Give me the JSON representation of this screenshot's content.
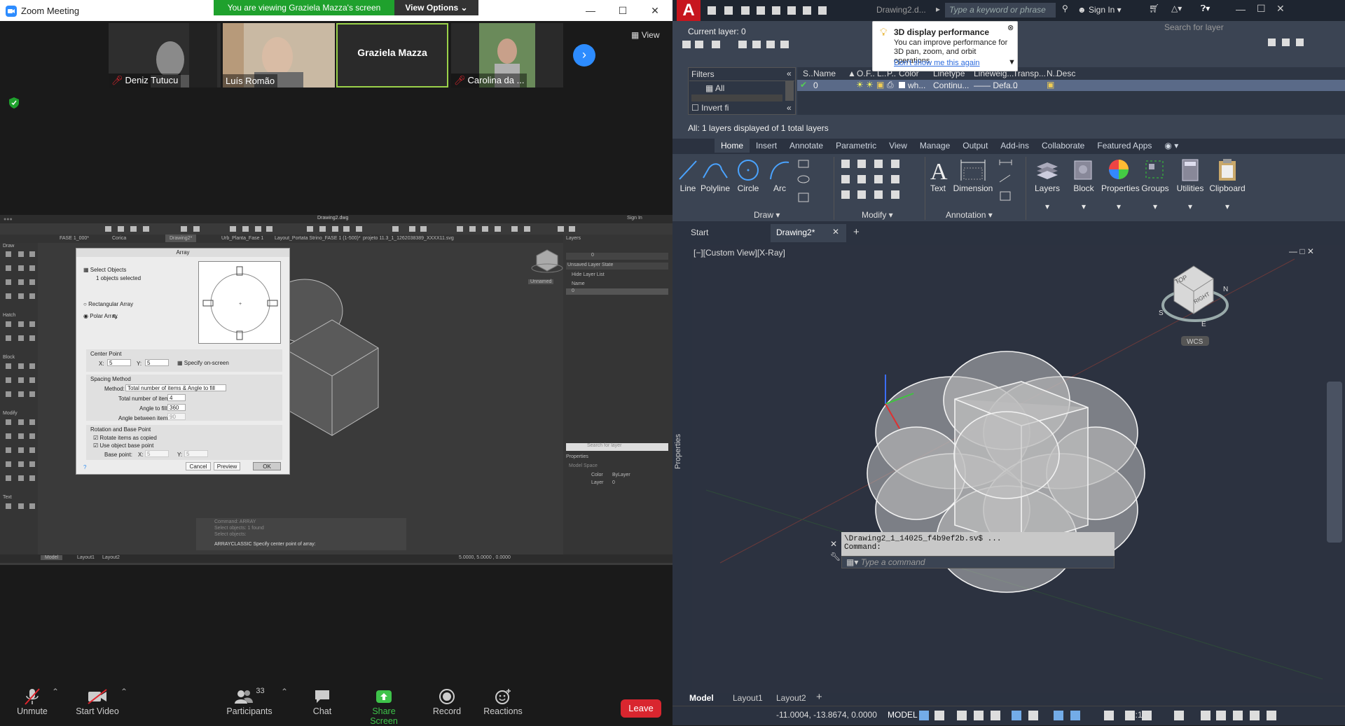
{
  "zoom": {
    "window_title": "Zoom Meeting",
    "banner_text": "You are viewing Graziela Mazza's screen",
    "view_options": "View Options",
    "view_label": "View",
    "participants": [
      {
        "name": "Deniz Tutucu",
        "muted": true
      },
      {
        "name": "Luís Romão",
        "muted": false
      },
      {
        "name": "Graziela Mazza",
        "muted": false
      },
      {
        "name": "Carolina da ...",
        "muted": true
      }
    ],
    "toolbar": {
      "unmute": "Unmute",
      "start_video": "Start Video",
      "participants": "Participants",
      "participants_count": "33",
      "chat": "Chat",
      "share_screen": "Share Screen",
      "record": "Record",
      "reactions": "Reactions",
      "leave": "Leave"
    },
    "colors": {
      "share_green": "#1fa12d",
      "leave_red": "#d9262f",
      "banner_bg": "#1fa12d"
    }
  },
  "remote": {
    "window_title": "Drawing2.dwg",
    "sign_in": "Sign In",
    "tabs": [
      "FASE 1_000*",
      "Corica",
      "Drawing2*",
      "Urb_Planta_Fase 1",
      "Layout_Portata Strino_FASE 1 (1-500)*",
      "projeto 11.3_1_1262038389_XXXX11.svg"
    ],
    "dialog": {
      "title": "Array",
      "select_objects": "Select Objects",
      "selected": "1 objects selected",
      "rect": "Rectangular Array",
      "polar": "Polar Array",
      "center_point": "Center Point",
      "x_label": "X:",
      "x_val": "5",
      "y_label": "Y:",
      "y_val": "5",
      "specify": "Specify on-screen",
      "spacing": "Spacing Method",
      "method_label": "Method:",
      "method_val": "Total number of items & Angle to fill",
      "total_label": "Total number of items:",
      "total_val": "4",
      "angle_label": "Angle to fill:",
      "angle_val": "360",
      "between_label": "Angle between items:",
      "between_val": "90",
      "rot": "Rotation and Base Point",
      "rotate": "Rotate items as copied",
      "use_base": "Use object base point",
      "base_label": "Base point:",
      "bx": "5",
      "by": "5",
      "cancel": "Cancel",
      "preview": "Preview",
      "ok": "OK",
      "help": "?"
    },
    "layers_title": "Layers",
    "layer_state": "Unsaved Layer State",
    "hide_list": "Hide Layer List",
    "name_col": "Name",
    "layer0": "0",
    "unnamed": "Unnamed",
    "search_layer": "Search for layer",
    "properties": "Properties",
    "model_space": "Model Space",
    "color_label": "Color",
    "color_val": "ByLayer",
    "layer_label": "Layer",
    "layer_val": "0",
    "cmd_lines": [
      "Command: ARRAY",
      "Select objects: 1 found",
      "Select objects:"
    ],
    "cmd_prompt": "ARRAYCLASSIC Specify center point of array:",
    "coords": "5.0000,  5.0000  ,  0.0000",
    "tabs_bottom": [
      "Model",
      "Layout1",
      "Layout2"
    ],
    "palette_sections": [
      "Draw",
      "Hatch",
      "Block",
      "Modify",
      "Text"
    ]
  },
  "acad": {
    "doc_title": "Drawing2.d...",
    "search_placeholder": "Type a keyword or phrase",
    "sign_in": "Sign In",
    "current_layer": "Current layer: 0",
    "search_layer": "Search for layer",
    "filters": "Filters",
    "all": "All",
    "invert": "Invert fi",
    "columns": [
      "S..",
      "Name",
      "O..",
      "F..",
      "L..",
      "P..",
      "Color",
      "Linetype",
      "Lineweig...",
      "Transp...",
      "N..",
      "Desc"
    ],
    "layer_row": {
      "name": "0",
      "color": "wh...",
      "linetype": "Continu...",
      "lineweight": "Defa...",
      "transp": "0"
    },
    "layers_summary": "All: 1 layers displayed of 1 total layers",
    "tooltip": {
      "title": "3D display performance",
      "body": "You can improve performance for 3D pan, zoom, and orbit operations.",
      "link": "Don't show me this again"
    },
    "ribbon_tabs": [
      "Home",
      "Insert",
      "Annotate",
      "Parametric",
      "View",
      "Manage",
      "Output",
      "Add-ins",
      "Collaborate",
      "Featured Apps"
    ],
    "draw_tools": [
      "Line",
      "Polyline",
      "Circle",
      "Arc"
    ],
    "ann_tools": [
      "Text",
      "Dimension"
    ],
    "big_tools": [
      "Layers",
      "Block",
      "Properties",
      "Groups",
      "Utilities",
      "Clipboard"
    ],
    "groups": {
      "draw": "Draw",
      "modify": "Modify",
      "annotation": "Annotation"
    },
    "doc_tabs": {
      "start": "Start",
      "drawing": "Drawing2*"
    },
    "viewport_label": "[−][Custom View][X-Ray]",
    "properties_side": "Properties",
    "wcs": "WCS",
    "viewcube": {
      "top": "TOP",
      "right": "RIGHT",
      "n": "N",
      "s": "S",
      "e": "E"
    },
    "cmd_history": "\\Drawing2_1_14025_f4b9ef2b.sv$ ...",
    "cmd_label": "Command:",
    "cmd_placeholder": "Type a command",
    "layout_tabs": [
      "Model",
      "Layout1",
      "Layout2"
    ],
    "coords": "-11.0004, -13.8674, 0.0000",
    "model": "MODEL",
    "scale": "1:1",
    "colors": {
      "cad_bg": "#2b3240",
      "panel": "#3b4453",
      "highlight": "#2d8cf0"
    }
  }
}
